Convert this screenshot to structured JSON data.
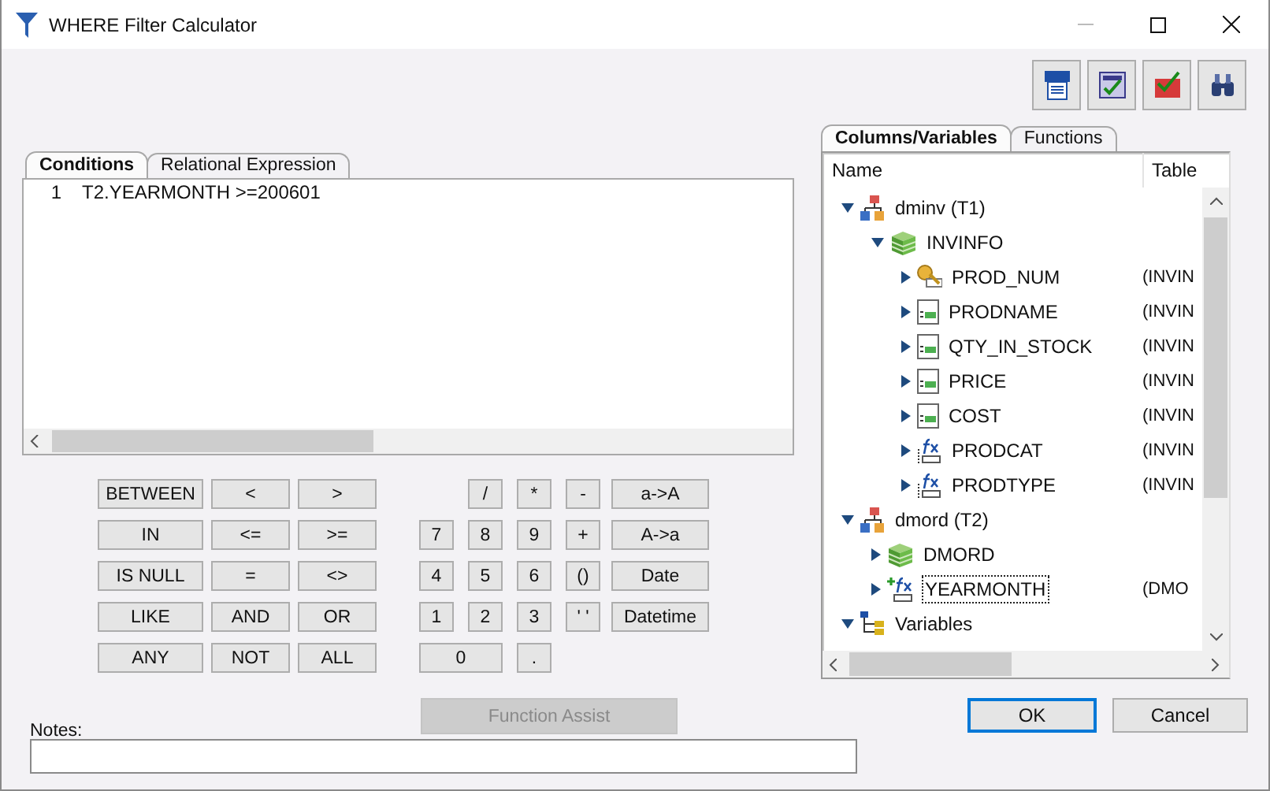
{
  "window": {
    "title": "WHERE Filter Calculator"
  },
  "toolbar": [
    {
      "kind": "sql"
    },
    {
      "kind": "validate"
    },
    {
      "kind": "sql-check"
    },
    {
      "kind": "find"
    }
  ],
  "left_tabs": [
    {
      "label": "Conditions",
      "selected": true
    },
    {
      "label": "Relational Expression",
      "selected": false
    }
  ],
  "editor": {
    "lines": [
      {
        "number": "1",
        "text": "T2.YEARMONTH >=200601"
      }
    ]
  },
  "keypad": {
    "operators": [
      [
        "BETWEEN",
        "<",
        ">"
      ],
      [
        "IN",
        "<=",
        ">="
      ],
      [
        "IS NULL",
        "=",
        "<>"
      ],
      [
        "LIKE",
        "AND",
        "OR"
      ],
      [
        "ANY",
        "NOT",
        "ALL"
      ]
    ],
    "numbers": [
      [
        {
          "label": "/",
          "kind": "key"
        },
        {
          "label": "*",
          "kind": "key"
        },
        {
          "label": "-",
          "kind": "key"
        },
        {
          "label": "a->A",
          "kind": "wide"
        }
      ],
      [
        {
          "label": "7",
          "kind": "key"
        },
        {
          "label": "8",
          "kind": "key"
        },
        {
          "label": "9",
          "kind": "key"
        },
        {
          "label": "+",
          "kind": "key"
        },
        {
          "label": "A->a",
          "kind": "wide"
        }
      ],
      [
        {
          "label": "4",
          "kind": "key"
        },
        {
          "label": "5",
          "kind": "key"
        },
        {
          "label": "6",
          "kind": "key"
        },
        {
          "label": "()",
          "kind": "key"
        },
        {
          "label": "Date",
          "kind": "wide"
        }
      ],
      [
        {
          "label": "1",
          "kind": "key"
        },
        {
          "label": "2",
          "kind": "key"
        },
        {
          "label": "3",
          "kind": "key"
        },
        {
          "label": "' '",
          "kind": "key"
        },
        {
          "label": "Datetime",
          "kind": "wide"
        }
      ],
      [
        {
          "label": "0",
          "kind": "zero"
        },
        {
          "label": ".",
          "kind": "key"
        }
      ]
    ]
  },
  "right_tabs": [
    {
      "label": "Columns/Variables",
      "selected": true
    },
    {
      "label": "Functions",
      "selected": false
    }
  ],
  "tree": {
    "columns": [
      "Name",
      "Table"
    ],
    "nodes": [
      {
        "name": "dminv (T1)",
        "kind": "library",
        "expanded": true,
        "selected": false,
        "children": [
          {
            "name": "INVINFO",
            "kind": "table",
            "expanded": true,
            "selected": false,
            "children": [
              {
                "name": "PROD_NUM",
                "kind": "key",
                "table": "(INVIN",
                "expanded": false,
                "selected": false
              },
              {
                "name": "PRODNAME",
                "kind": "column",
                "table": "(INVIN",
                "expanded": false,
                "selected": false
              },
              {
                "name": "QTY_IN_STOCK",
                "kind": "column",
                "table": "(INVIN",
                "expanded": false,
                "selected": false
              },
              {
                "name": "PRICE",
                "kind": "column",
                "table": "(INVIN",
                "expanded": false,
                "selected": false
              },
              {
                "name": "COST",
                "kind": "column",
                "table": "(INVIN",
                "expanded": false,
                "selected": false
              },
              {
                "name": "PRODCAT",
                "kind": "computed",
                "table": "(INVIN",
                "expanded": false,
                "selected": false
              },
              {
                "name": "PRODTYPE",
                "kind": "computed",
                "table": "(INVIN",
                "expanded": false,
                "selected": false
              }
            ]
          }
        ]
      },
      {
        "name": "dmord (T2)",
        "kind": "library",
        "expanded": true,
        "selected": false,
        "children": [
          {
            "name": "DMORD",
            "kind": "table",
            "expanded": false,
            "selected": false
          },
          {
            "name": "YEARMONTH",
            "kind": "new-computed",
            "table": "(DMO",
            "expanded": false,
            "selected": true
          }
        ]
      },
      {
        "name": "Variables",
        "kind": "variables",
        "expanded": true,
        "selected": false
      }
    ]
  },
  "function_assist": {
    "label": "Function Assist",
    "disabled": true
  },
  "notes": {
    "label": "Notes:"
  },
  "buttons": [
    {
      "label": "OK",
      "default": true
    },
    {
      "label": "Cancel",
      "default": false
    }
  ]
}
